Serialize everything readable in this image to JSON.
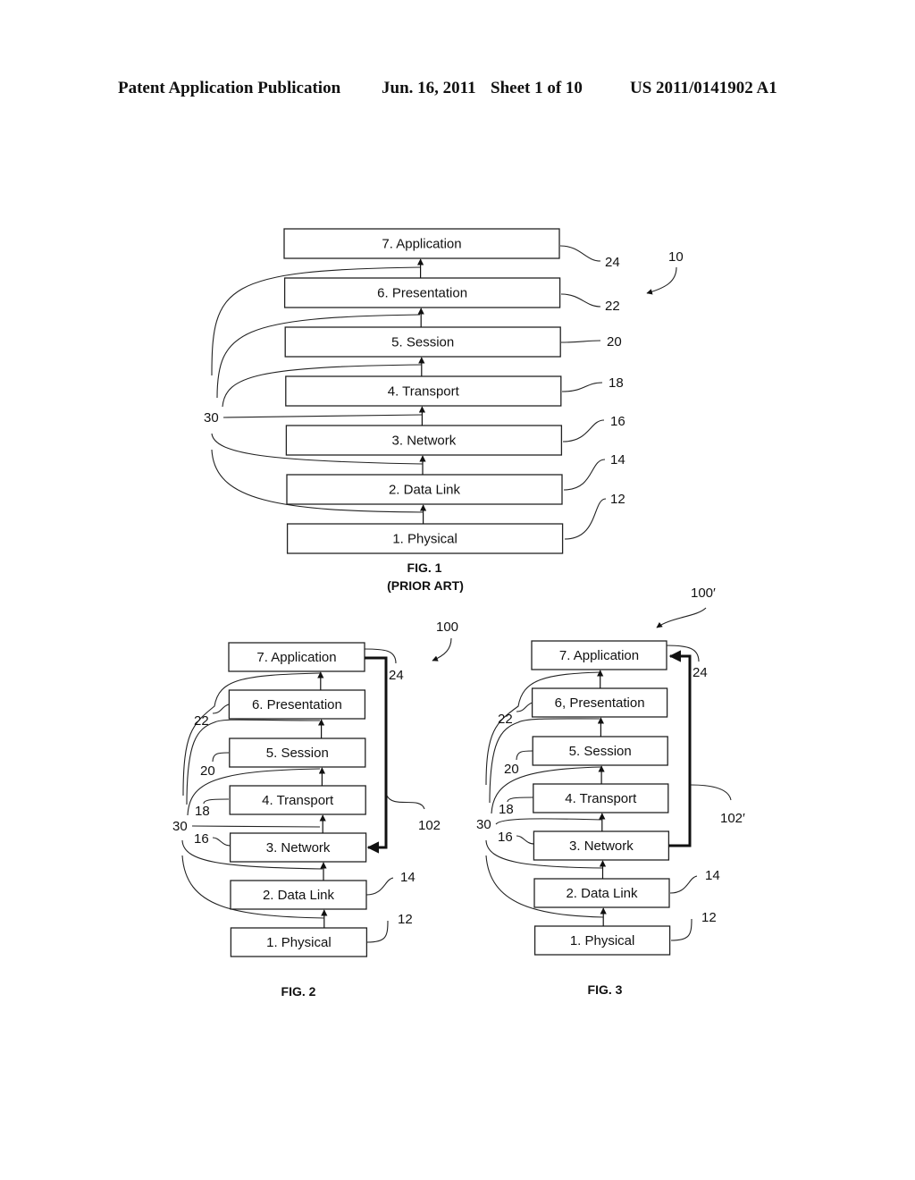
{
  "header": {
    "publication": "Patent Application Publication",
    "date": "Jun. 16, 2011",
    "sheet": "Sheet 1 of 10",
    "number": "US 2011/0141902 A1"
  },
  "layers": [
    {
      "label": "7.  Application",
      "ref": "24"
    },
    {
      "label": "6.  Presentation",
      "ref": "22"
    },
    {
      "label": "5.  Session",
      "ref": "20"
    },
    {
      "label": "4.  Transport",
      "ref": "18"
    },
    {
      "label": "3.  Network",
      "ref": "16"
    },
    {
      "label": "2.  Data Link",
      "ref": "14"
    },
    {
      "label": "1.  Physical",
      "ref": "12"
    }
  ],
  "fig1": {
    "ref": "10",
    "bypass_ref": "30",
    "caption": "FIG. 1",
    "subcaption": "(PRIOR ART)"
  },
  "fig2": {
    "ref": "100",
    "bypass_ref": "30",
    "shortcut_ref": "102",
    "shortcut": {
      "from": "7. Application",
      "to": "3. Network"
    },
    "caption": "FIG. 2"
  },
  "fig3": {
    "ref": "100′",
    "bypass_ref": "30",
    "shortcut_ref": "102′",
    "shortcut": {
      "from": "3. Network",
      "to": "7. Application"
    },
    "caption": "FIG. 3",
    "presentation_label": "6,  Presentation"
  }
}
